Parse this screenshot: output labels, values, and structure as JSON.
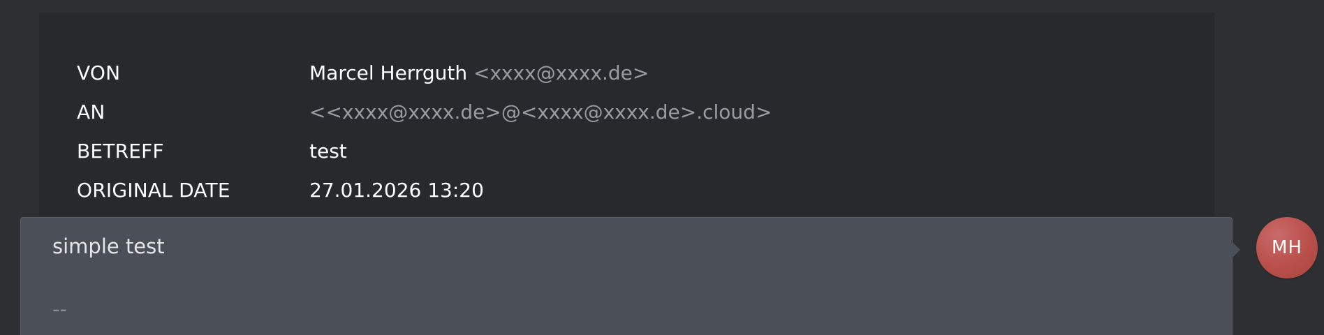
{
  "header": {
    "rows": [
      {
        "label": "VON",
        "value_name": "Marcel Herrguth",
        "value_email": "<xxxx@xxxx.de>"
      },
      {
        "label": "AN",
        "value": "<<xxxx@xxxx.de>@<xxxx@xxxx.de>.cloud>"
      },
      {
        "label": "BETREFF",
        "value": "test"
      },
      {
        "label": "ORIGINAL DATE",
        "value": "27.01.2026 13:20"
      }
    ]
  },
  "message": {
    "body": "simple test",
    "signature_separator": "--"
  },
  "avatar": {
    "initials": "MH",
    "color": "#b94f4a"
  },
  "colors": {
    "page_background": "#2e2f33",
    "meta_background": "#28292d",
    "card_background": "#4b4f57",
    "muted_text": "#9a9ca3"
  }
}
